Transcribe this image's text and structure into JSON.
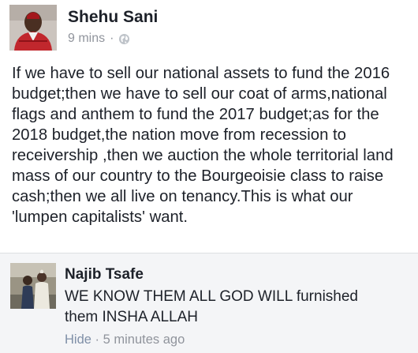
{
  "post": {
    "author": "Shehu Sani",
    "time": "9 mins",
    "separator": "·",
    "privacy_icon": "globe-icon",
    "body": "If we have to sell our national assets to fund the 2016\nbudget;then we have to sell our coat of arms,national\nflags and anthem to fund the 2017 budget;as for the\n2018 budget,the nation move from recession to\nreceivership ,then we auction the whole territorial land\nmass of our country to the Bourgeoisie class to raise\ncash;then we all live on tenancy.This is what our\n'lumpen capitalists' want."
  },
  "comment": {
    "author": "Najib Tsafe",
    "text": "WE KNOW THEM ALL GOD WILL furnished\nthem INSHA ALLAH",
    "hide_label": "Hide",
    "separator": "·",
    "time": "5 minutes ago"
  },
  "colors": {
    "text": "#1d2129",
    "meta": "#90949c",
    "link": "#7f8fa7",
    "comment_bg": "#f4f5f7"
  }
}
